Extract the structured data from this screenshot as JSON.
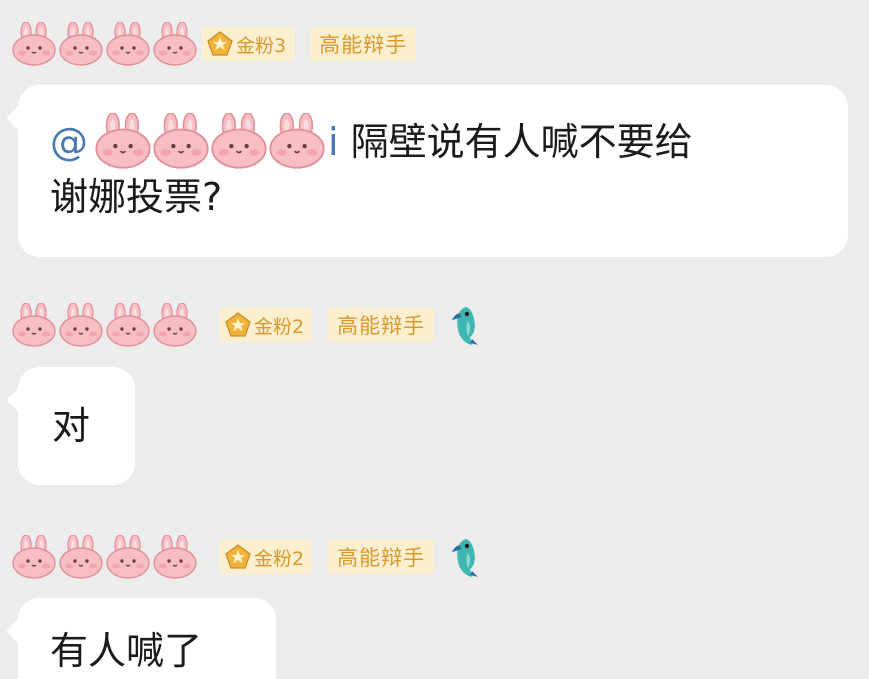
{
  "messages": [
    {
      "fan_badge": "金粉3",
      "title_badge": "高能辩手",
      "has_bird": false,
      "mention_prefix": "@",
      "mention_suffix": "i",
      "text_line1": "隔壁说有人喊不要给",
      "text_line2": "谢娜投票?"
    },
    {
      "fan_badge": "金粉2",
      "title_badge": "高能辩手",
      "has_bird": true,
      "text": "对"
    },
    {
      "fan_badge": "金粉2",
      "title_badge": "高能辩手",
      "has_bird": true,
      "text": "有人喊了"
    }
  ],
  "icons": {
    "sticker": "pink-bunny-sticker-icon",
    "fan_badge": "pentagon-star-badge-icon",
    "bird": "blue-bird-icon"
  },
  "colors": {
    "background": "#ececec",
    "bubble": "#ffffff",
    "badge_bg": "#fcefcf",
    "badge_text": "#d9982c",
    "mention": "#4a78b6",
    "bunny": "#f7bfc4"
  }
}
